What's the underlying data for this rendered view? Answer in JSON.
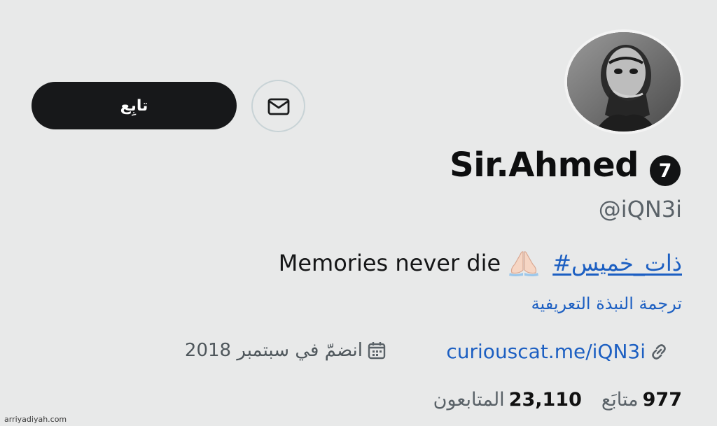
{
  "profile": {
    "display_name": "Sir.Ahmed",
    "badge_number": "7",
    "handle": "@iQN3i",
    "bio_text": "Memories never die",
    "bio_hashtag": "#ذات_خميس",
    "translate_label": "ترجمة النبذة التعريفية",
    "website": "curiouscat.me/iQN3i",
    "joined": "انضمّ في سبتمبر 2018"
  },
  "actions": {
    "follow_label": "تابِع",
    "message_icon": "envelope-icon"
  },
  "stats": {
    "following_count": "977",
    "following_label": "متابَع",
    "followers_count": "23,110",
    "followers_label": "المتابعون"
  },
  "icons": {
    "link": "link-icon",
    "calendar": "calendar-icon",
    "pray": "folded-hands-emoji"
  },
  "colors": {
    "background": "#e8e9e9",
    "button_dark": "#17181a",
    "link_blue": "#1c5fc2",
    "muted_text": "#5a6268"
  },
  "watermark": "arriyadiyah.com"
}
